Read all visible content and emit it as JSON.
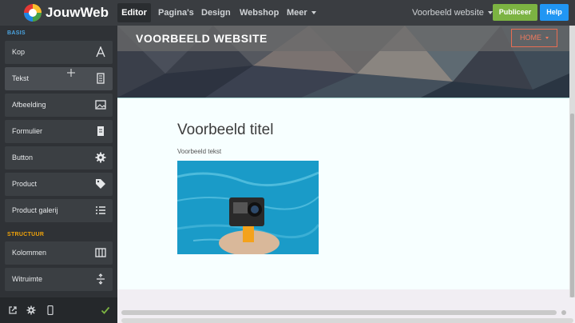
{
  "app": {
    "name": "JouwWeb"
  },
  "nav": {
    "editor": "Editor",
    "pages": "Pagina's",
    "design": "Design",
    "webshop": "Webshop",
    "more": "Meer",
    "site_select": "Voorbeeld website",
    "publish": "Publiceer",
    "help": "Help"
  },
  "sidebar": {
    "basis_label": "BASIS",
    "structuur_label": "STRUCTUUR",
    "items": [
      {
        "label": "Kop",
        "icon": "heading-icon"
      },
      {
        "label": "Tekst",
        "icon": "text-document-icon"
      },
      {
        "label": "Afbeelding",
        "icon": "image-icon"
      },
      {
        "label": "Formulier",
        "icon": "form-icon"
      },
      {
        "label": "Button",
        "icon": "gear-button-icon"
      },
      {
        "label": "Product",
        "icon": "tag-icon"
      },
      {
        "label": "Product galerij",
        "icon": "list-icon"
      },
      {
        "label": "Kolommen",
        "icon": "columns-icon"
      },
      {
        "label": "Witruimte",
        "icon": "spacing-icon"
      }
    ],
    "bottom_icons": [
      "external-link-icon",
      "settings-icon",
      "mobile-icon",
      "check-icon"
    ]
  },
  "site": {
    "title": "VOORBEELD WEBSITE",
    "home_menu": "HOME",
    "page_title": "Voorbeeld titel",
    "page_text": "Voorbeeld tekst"
  },
  "colors": {
    "publish": "#7cb342",
    "help": "#2196f3",
    "section_basis": "#4aa3df",
    "section_structuur": "#f0a30a",
    "home_accent": "#e86d52"
  }
}
